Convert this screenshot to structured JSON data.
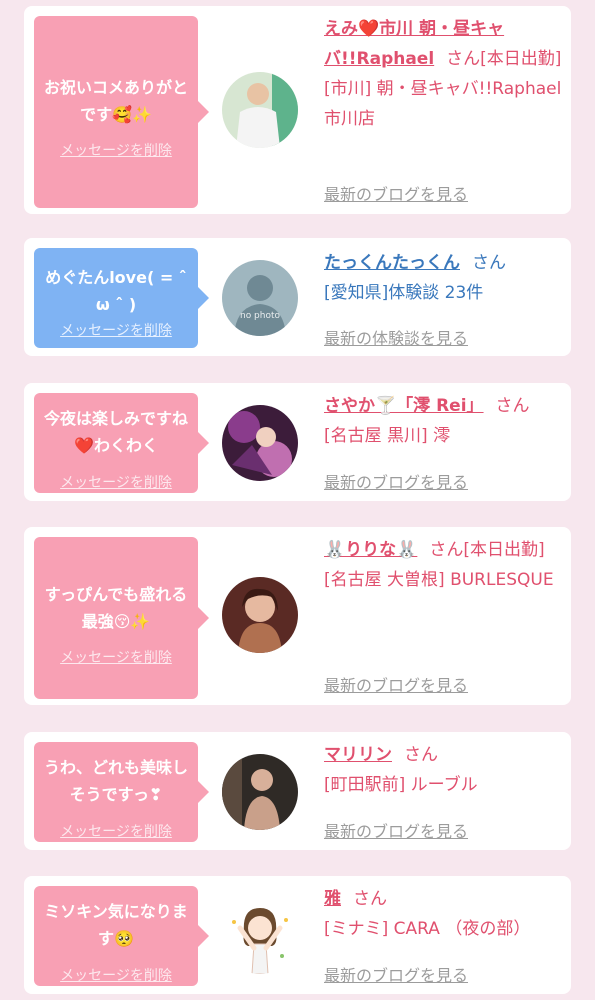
{
  "delete_label": "メッセージを削除",
  "honorific": "さん",
  "colors": {
    "background": "#f7e7ee",
    "bubble_pink": "#f8a0b4",
    "bubble_blue": "#7fb3f3",
    "name_pink": "#e0506e",
    "name_blue": "#3a78bc",
    "link_gray": "#9c9c9c"
  },
  "entries": [
    {
      "message": "お祝いコメありがとです🥰✨",
      "bubble_color": "pink",
      "name": "えみ❤️市川 朝・昼キャバ!!Raphael",
      "status": "[本日出勤]",
      "shop": "[市川] 朝・昼キャバ!!Raphael 市川店",
      "link": "最新のブログを見る"
    },
    {
      "message": "めぐたんlove( = ˆ ω ˆ )",
      "bubble_color": "blue",
      "name": "たっくんたっくん",
      "status": "",
      "shop": "[愛知県]体験談 23件",
      "link": "最新の体験談を見る",
      "avatar_text": "no photo"
    },
    {
      "message": "今夜は楽しみですね❤️わくわく",
      "bubble_color": "pink",
      "name": "さやか🍸「澪 Rei」",
      "status": "",
      "shop": "[名古屋 黒川] 澪",
      "link": "最新のブログを見る"
    },
    {
      "message": "すっぴんでも盛れる最強😚✨",
      "bubble_color": "pink",
      "name": "🐰りりな🐰",
      "status": "[本日出勤]",
      "shop": "[名古屋 大曽根] BURLESQUE",
      "link": "最新のブログを見る"
    },
    {
      "message": "うわ、どれも美味しそうですっ❣",
      "bubble_color": "pink",
      "name": "マリリン",
      "status": "",
      "shop": "[町田駅前] ルーブル",
      "link": "最新のブログを見る"
    },
    {
      "message": "ミソキン気になります🥺",
      "bubble_color": "pink",
      "name": "雅",
      "status": "",
      "shop": "[ミナミ] CARA （夜の部）",
      "link": "最新のブログを見る"
    }
  ]
}
